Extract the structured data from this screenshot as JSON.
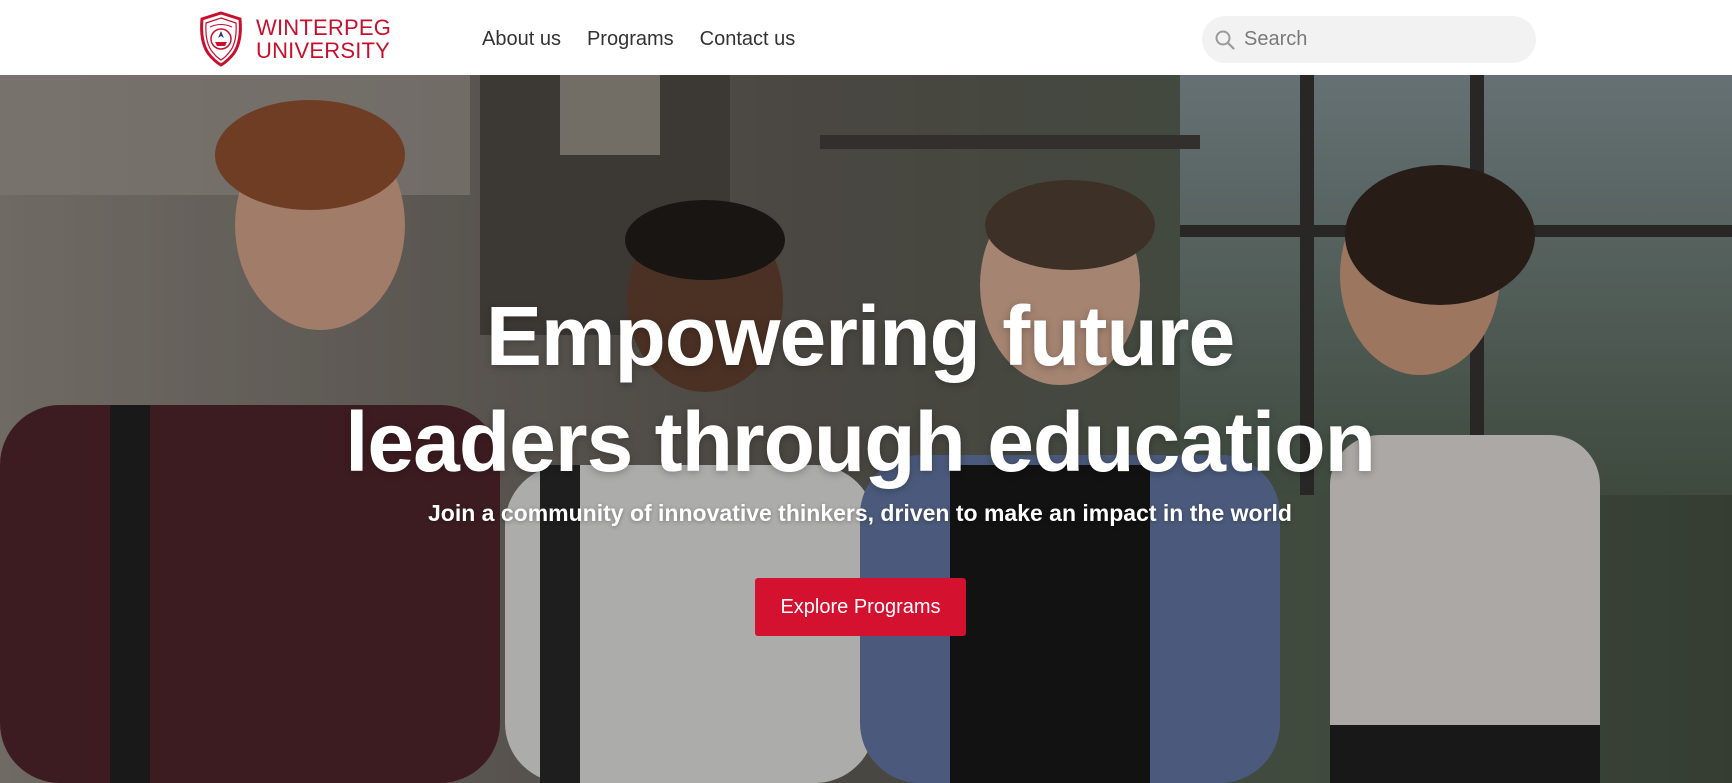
{
  "brand": {
    "line1": "WINTERPEG",
    "line2": "UNIVERSITY",
    "color": "#c8102e"
  },
  "nav": {
    "items": [
      {
        "label": "About us"
      },
      {
        "label": "Programs"
      },
      {
        "label": "Contact us"
      }
    ]
  },
  "search": {
    "placeholder": "Search",
    "value": "",
    "icon": "search-icon"
  },
  "hero": {
    "title_line1": "Empowering future",
    "title_line2": "leaders through education",
    "subtitle": "Join a community of innovative thinkers, driven to make an impact in the world",
    "cta_label": "Explore Programs",
    "cta_color": "#d4112f"
  }
}
